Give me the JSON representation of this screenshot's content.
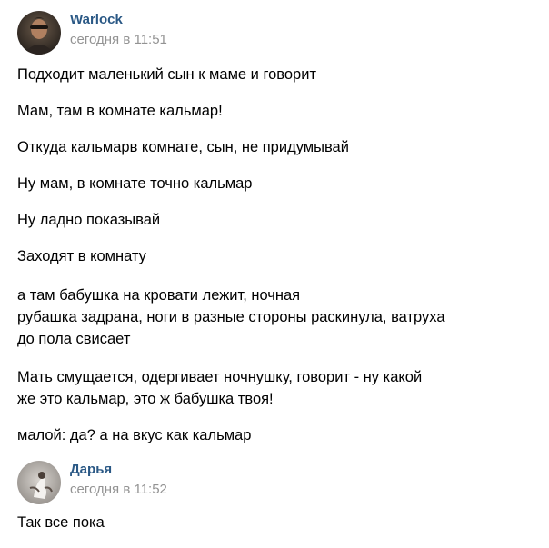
{
  "posts": [
    {
      "author": "Warlock",
      "time": "сегодня в 11:51",
      "avatar": "user-photo-avatar",
      "lines": [
        "Подходит маленький сын к маме и говорит",
        "Мам, там в комнате кальмар!",
        "Откуда кальмарв комнате, сын, не придумывай",
        "Ну мам, в комнате точно кальмар",
        "Ну ладно показывай",
        "Заходят в комнату",
        "а там бабушка на кровати лежит, ночная",
        "рубашка задрана, ноги в разные стороны раскинула, ватруха",
        "до пола свисает",
        "Мать смущается, одергивает ночнушку, говорит - ну какой",
        "же это кальмар, это ж бабушка твоя!",
        "малой: да? а на вкус как кальмар"
      ]
    },
    {
      "author": "Дарья",
      "time": "сегодня в 11:52",
      "avatar": "figure-photo-avatar",
      "lines": [
        "Так все пока"
      ]
    }
  ],
  "colors": {
    "author_link": "#2a5885",
    "timestamp": "#939393",
    "text": "#000000",
    "background": "#ffffff"
  }
}
